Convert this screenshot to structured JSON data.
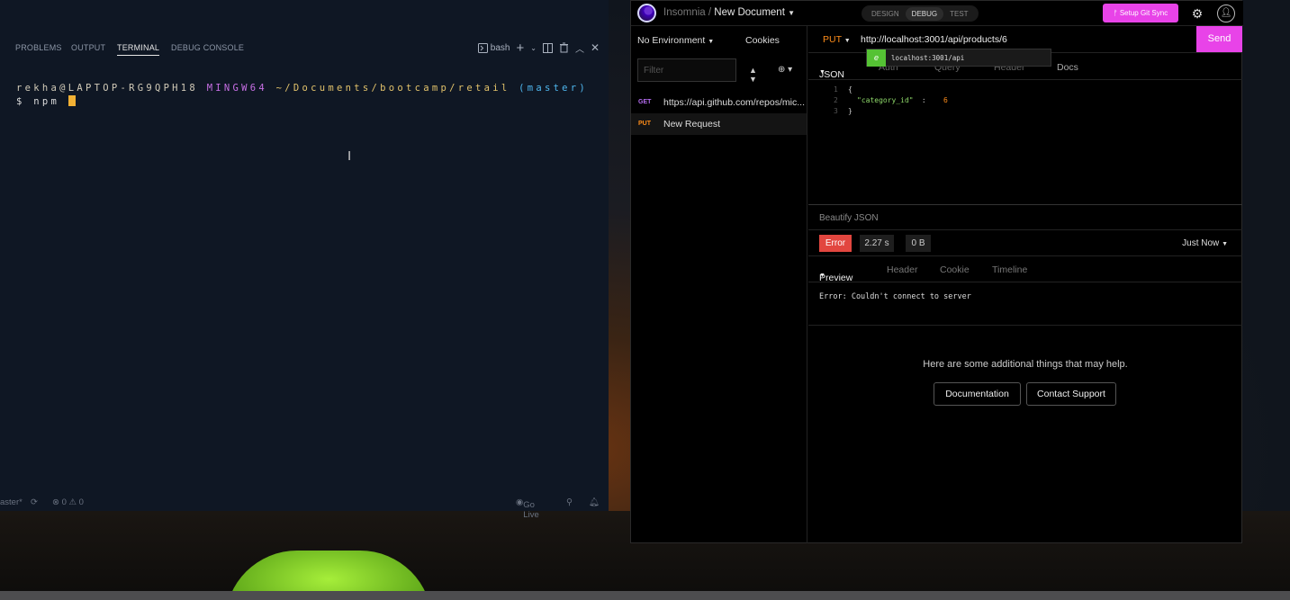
{
  "vscode": {
    "panel_tabs": [
      "PROBLEMS",
      "OUTPUT",
      "TERMINAL",
      "DEBUG CONSOLE"
    ],
    "active_tab": "TERMINAL",
    "shell_label": "bash",
    "terminal": {
      "user_host": "rekha@LAPTOP-RG9QPH18",
      "system": "MINGW64",
      "path": "~/Documents/bootcamp/retail",
      "branch": "(master)",
      "prompt": "$",
      "command": "npm"
    },
    "status": {
      "branch": "aster*",
      "problems": "⊗ 0 ⚠ 0",
      "go_live": "Go Live"
    }
  },
  "insomnia": {
    "app_name": "Insomnia",
    "separator": "/",
    "document": "New Document",
    "modes": [
      "DESIGN",
      "DEBUG",
      "TEST"
    ],
    "active_mode": "DEBUG",
    "git_sync_label": "Setup Git Sync",
    "environment": "No Environment",
    "cookies_label": "Cookies",
    "filter_placeholder": "Filter",
    "requests": [
      {
        "method": "GET",
        "name": "https://api.github.com/repos/mic...",
        "method_color": "#b46cf0"
      },
      {
        "method": "PUT",
        "name": "New Request",
        "method_color": "#ff8d1a"
      }
    ],
    "method": "PUT",
    "url": "http://localhost:3001/api/products/6",
    "send_label": "Send",
    "autocomplete": {
      "badge": "e",
      "text": "localhost:3001/api"
    },
    "request_tabs": [
      "JSON",
      "Auth",
      "Query",
      "Header",
      "Docs"
    ],
    "body_lines": [
      {
        "num": "1",
        "text": "{"
      },
      {
        "num": "2",
        "key": "\"category_id\"",
        "sep": " : ",
        "value": "6"
      },
      {
        "num": "3",
        "text": "}"
      }
    ],
    "beautify_label": "Beautify JSON",
    "response": {
      "status": "Error",
      "time": "2.27 s",
      "size": "0 B",
      "when": "Just Now",
      "tabs": [
        "Preview",
        "Header",
        "Cookie",
        "Timeline"
      ],
      "error_message": "Error: Couldn't connect to server",
      "help_text": "Here are some additional things that may help.",
      "documentation_label": "Documentation",
      "support_label": "Contact Support"
    }
  }
}
